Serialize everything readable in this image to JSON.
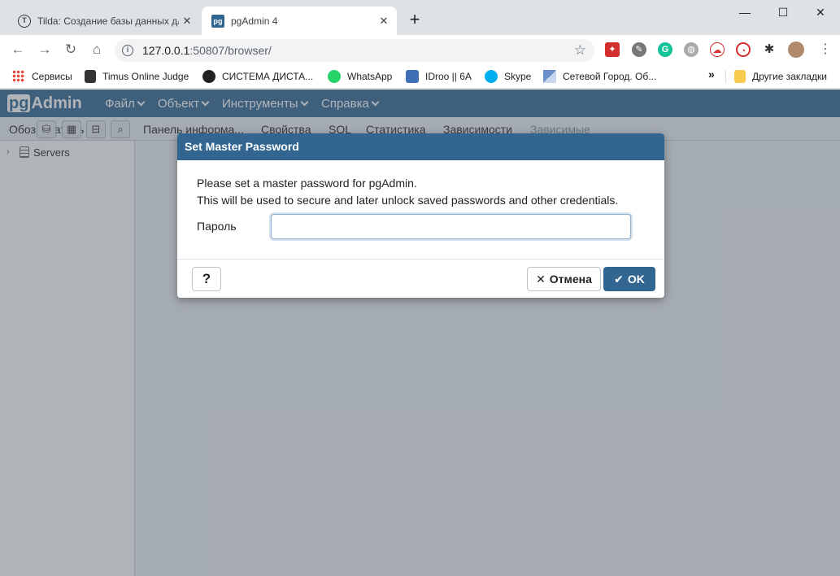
{
  "browser": {
    "tabs": [
      {
        "title": "Tilda: Создание базы данных дл",
        "favicon": "tilda-icon",
        "active": false
      },
      {
        "title": "pgAdmin 4",
        "favicon": "pgadmin-icon",
        "active": true
      }
    ],
    "favicon_letters": {
      "tilda": "T",
      "pgadmin": "pg"
    },
    "url_host": "127.0.0.1",
    "url_rest": ":50807/browser/",
    "bookmarks": [
      {
        "label": "Сервисы",
        "icon": "apps-grid-icon"
      },
      {
        "label": "Timus Online Judge",
        "icon": "timus-icon"
      },
      {
        "label": "СИСТЕМА ДИСТА...",
        "icon": "globe-icon"
      },
      {
        "label": "WhatsApp",
        "icon": "whatsapp-icon"
      },
      {
        "label": "IDroo || 6A",
        "icon": "idroo-icon"
      },
      {
        "label": "Skype",
        "icon": "skype-icon"
      },
      {
        "label": "Сетевой Город. Об...",
        "icon": "netcity-icon"
      }
    ],
    "bookmarks_more": "»",
    "other_bookmarks": "Другие закладки"
  },
  "pgadmin": {
    "logo_pg": "pg",
    "logo_rest": "Admin",
    "menu": [
      "Файл",
      "Объект",
      "Инструменты",
      "Справка"
    ],
    "browser_panel_title": "Обозреватель",
    "tree": [
      {
        "label": "Servers"
      }
    ],
    "tabs": [
      {
        "label": "Панель информа...",
        "dim": false
      },
      {
        "label": "Свойства",
        "dim": false
      },
      {
        "label": "SQL",
        "dim": false
      },
      {
        "label": "Статистика",
        "dim": false
      },
      {
        "label": "Зависимости",
        "dim": false
      },
      {
        "label": "Зависимые",
        "dim": true
      }
    ]
  },
  "dialog": {
    "title": "Set Master Password",
    "line1": "Please set a master password for pgAdmin.",
    "line2": "This will be used to secure and later unlock saved passwords and other credentials.",
    "password_label": "Пароль",
    "password_value": "",
    "help_label": "?",
    "cancel_label": "Отмена",
    "ok_label": "OK"
  },
  "colors": {
    "pgadmin_blue": "#326690",
    "overlay": "rgba(80,88,100,0.45)"
  }
}
